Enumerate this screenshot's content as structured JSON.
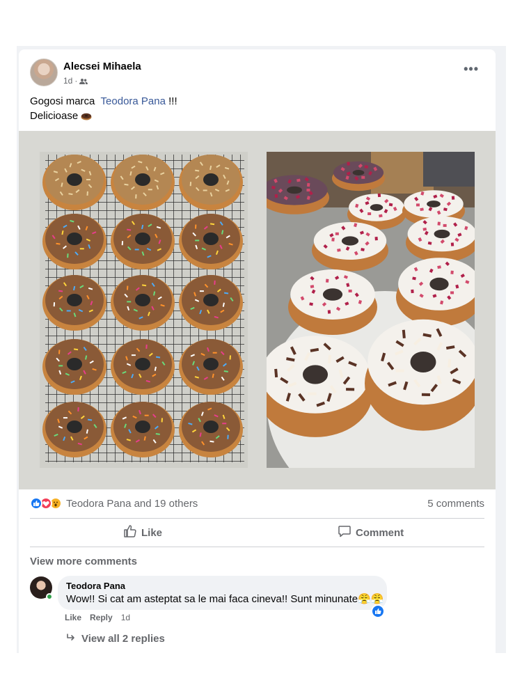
{
  "post": {
    "author": "Alecsei Mihaela",
    "time": "1d",
    "separator": "·",
    "audience_icon": "friends-icon",
    "text_prefix": "Gogosi marca",
    "mention": "Teodora Pana",
    "text_suffix": "!!!",
    "line2": "Delicioase",
    "line2_emoji": "doughnut-emoji",
    "more_label": "•••"
  },
  "photos": [
    {
      "subject": "chocolate-glazed doughnuts with sprinkles on cooling rack"
    },
    {
      "subject": "white-glazed doughnuts with raspberry and chocolate toppings"
    }
  ],
  "reactions": {
    "icons": [
      "like-icon",
      "love-icon",
      "wow-icon"
    ],
    "summary": "Teodora Pana and 19 others",
    "comments_count": "5 comments"
  },
  "actions": {
    "like_label": "Like",
    "comment_label": "Comment"
  },
  "comments": {
    "view_more": "View more comments",
    "items": [
      {
        "author": "Teodora Pana",
        "text": "Wow!! Si cat am asteptat sa le mai faca cineva!! Sunt minunate",
        "emoji": "😤😤",
        "like_label": "Like",
        "reply_label": "Reply",
        "time": "1d",
        "view_replies": "View all 2 replies"
      }
    ]
  },
  "colors": {
    "accent": "#1877f2",
    "mention": "#385898",
    "secondary_text": "#65676b",
    "love": "#f33e58",
    "wow": "#f7b125",
    "online": "#31a24c"
  }
}
